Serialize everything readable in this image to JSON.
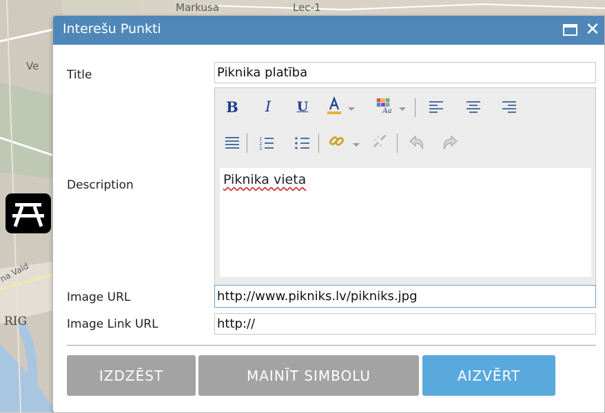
{
  "map": {
    "labels": [
      "Markusa",
      "Lec-1",
      "Ve",
      "RIG",
      "na Vald"
    ]
  },
  "popup": {
    "title": "Interešu Punkti",
    "maximize_icon": "maximize-icon",
    "close_label": "✕"
  },
  "form": {
    "title_label": "Title",
    "title_value": "Piknika platība",
    "description_label": "Description",
    "description_value": "Piknika vieta",
    "image_url_label": "Image URL",
    "image_url_value": "http://www.pikniks.lv/pikniks.jpg",
    "image_link_label": "Image Link URL",
    "image_link_value": "http://"
  },
  "toolbar": {
    "bold": "B",
    "italic": "I",
    "underline": "U",
    "font_color": "A"
  },
  "buttons": {
    "delete": "IZDZĒST",
    "change_symbol": "MAINĪT SIMBOLU",
    "close": "AIZVĒRT"
  },
  "colors": {
    "title_bar": "#4f88b8",
    "primary_button": "#5aa9dc",
    "secondary_button": "#a3a3a3"
  }
}
